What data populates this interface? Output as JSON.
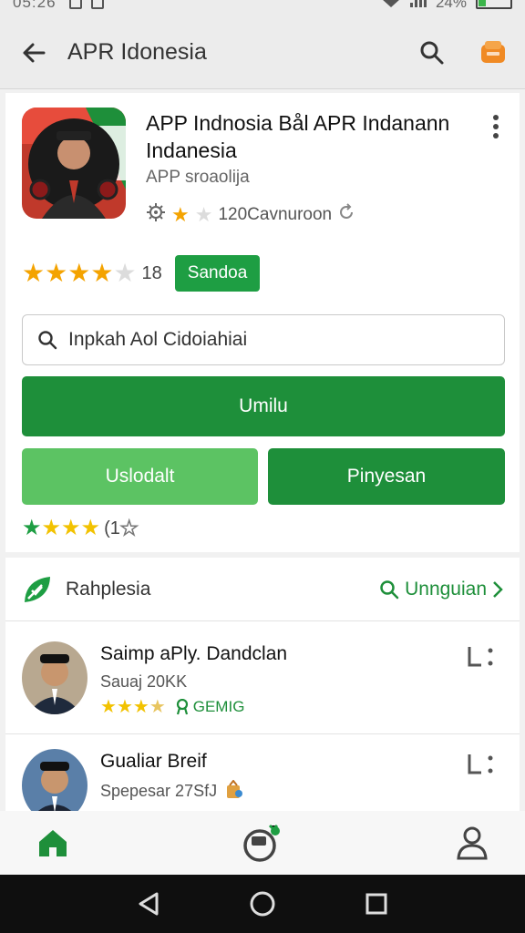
{
  "status_bar": {
    "time": "05:26",
    "battery": "24%",
    "battery_level": 0.24
  },
  "app_bar": {
    "title": "APR Idonesia",
    "search_icon": "search-icon",
    "store_icon": "store-icon"
  },
  "app": {
    "title": "APP Indnosia Bål APR Indanann Indanesia",
    "developer": "APP sroaolija",
    "meta_text": "120Cavnuroon",
    "meta_rating": 1,
    "rating": 4,
    "rating_count": "18",
    "badge": "Sandoa"
  },
  "search": {
    "value": "Inpkah Aol Cidoiahiai"
  },
  "buttons": {
    "primary": "Umilu",
    "secondary": "Uslodalt",
    "tertiary": "Pinyesan"
  },
  "secondary_rating": {
    "stars": 4,
    "text": "(1"
  },
  "section": {
    "title": "Rahplesia",
    "more_label": "Unnguian"
  },
  "list": [
    {
      "name": "Saimp aPly. Dandclan",
      "subtitle": "Sauaj 20KK",
      "rating": 3.5,
      "tag": "GEMIG"
    },
    {
      "name": "Gualiar Breif",
      "subtitle": "Spepesar 27SfJ"
    }
  ],
  "colors": {
    "accent": "#1e8f3a",
    "accent_light": "#5cc363",
    "star": "#f4a300"
  },
  "bottom_nav": [
    "home-icon",
    "games-icon",
    "profile-icon"
  ]
}
